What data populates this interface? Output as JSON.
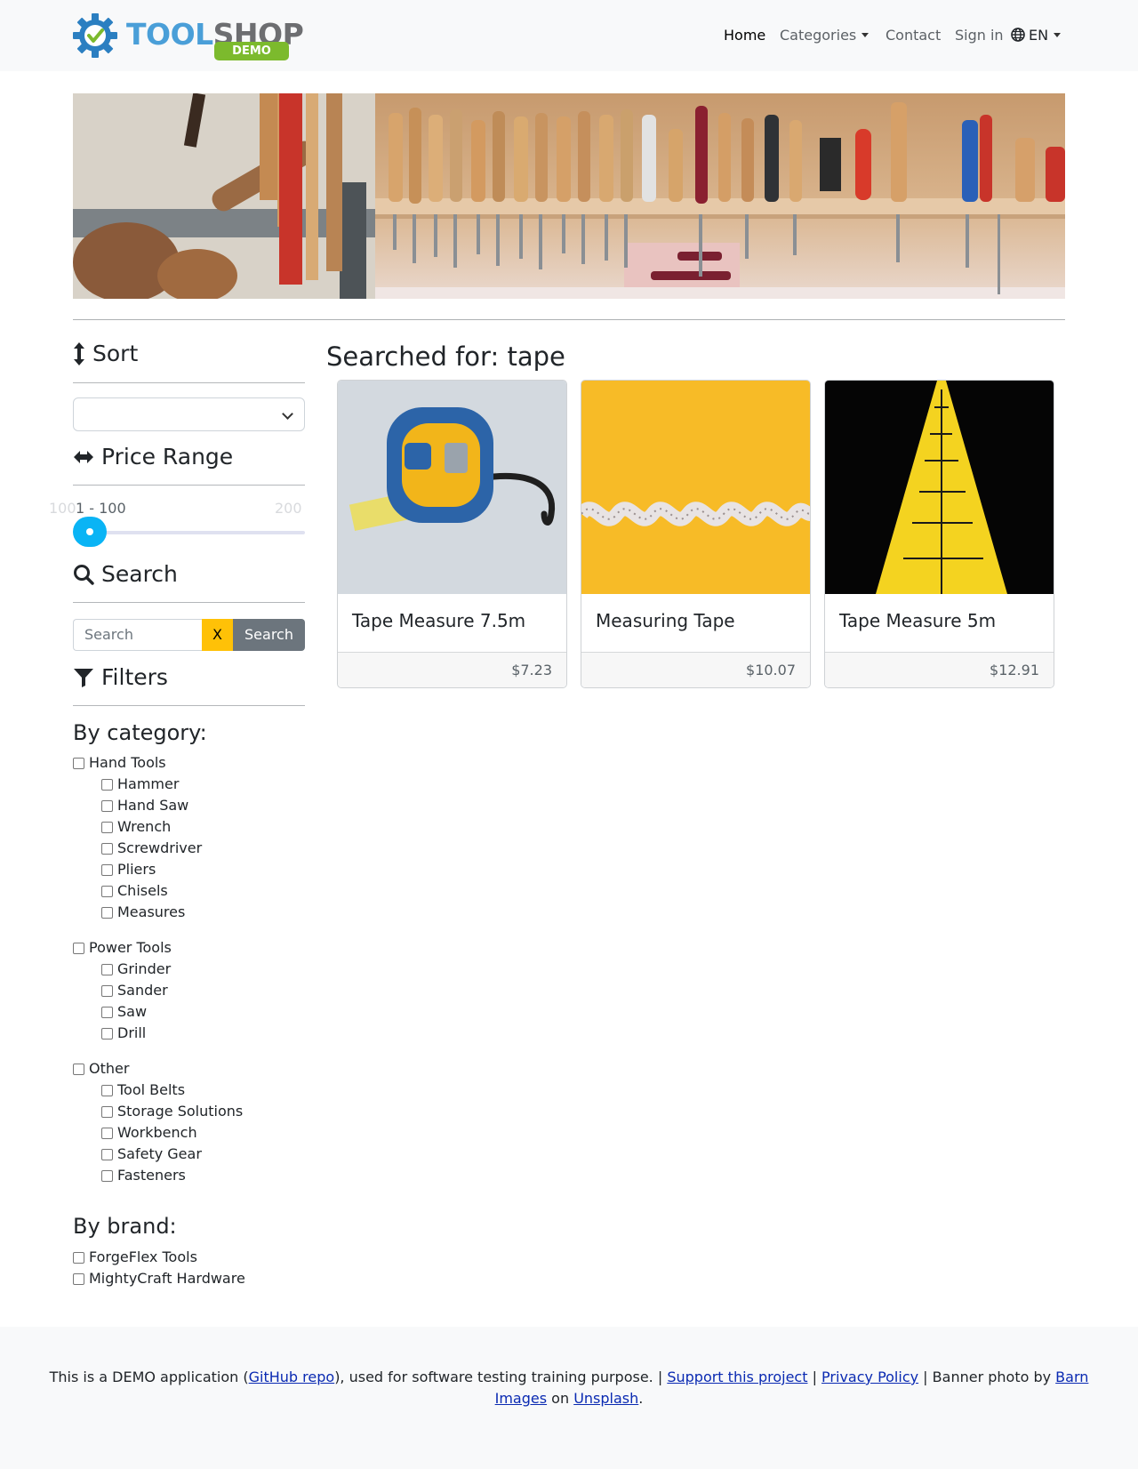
{
  "brand": {
    "part1": "TOOL",
    "part2": "SHOP",
    "badge": "DEMO"
  },
  "nav": {
    "home": "Home",
    "categories": "Categories",
    "contact": "Contact",
    "signin": "Sign in",
    "language": "EN"
  },
  "sidebar": {
    "sort": {
      "heading": "Sort",
      "selected": ""
    },
    "price": {
      "heading": "Price Range",
      "min_label": "1",
      "max_label": "200",
      "current_label": "1 - 100",
      "start_label": "100",
      "value": [
        1,
        100
      ]
    },
    "search": {
      "heading": "Search",
      "placeholder": "Search",
      "clear_label": "X",
      "button_label": "Search"
    },
    "filters": {
      "heading": "Filters",
      "by_category": "By category:",
      "categories": [
        {
          "label": "Hand Tools",
          "children": [
            "Hammer",
            "Hand Saw",
            "Wrench",
            "Screwdriver",
            "Pliers",
            "Chisels",
            "Measures"
          ]
        },
        {
          "label": "Power Tools",
          "children": [
            "Grinder",
            "Sander",
            "Saw",
            "Drill"
          ]
        },
        {
          "label": "Other",
          "children": [
            "Tool Belts",
            "Storage Solutions",
            "Workbench",
            "Safety Gear",
            "Fasteners"
          ]
        }
      ],
      "by_brand": "By brand:",
      "brands": [
        "ForgeFlex Tools",
        "MightyCraft Hardware"
      ]
    }
  },
  "main": {
    "heading": "Searched for: tape",
    "products": [
      {
        "title": "Tape Measure 7.5m",
        "price": "$7.23"
      },
      {
        "title": "Measuring Tape",
        "price": "$10.07"
      },
      {
        "title": "Tape Measure 5m",
        "price": "$12.91"
      }
    ]
  },
  "footer": {
    "t1": "This is a DEMO application (",
    "github": "GitHub repo",
    "t2": "), used for software testing training purpose. | ",
    "support": "Support this project",
    "sep": " | ",
    "privacy": "Privacy Policy",
    "t3": " | Banner photo by ",
    "barn": "Barn Images",
    "t4": " on ",
    "unsplash": "Unsplash",
    "t5": "."
  }
}
